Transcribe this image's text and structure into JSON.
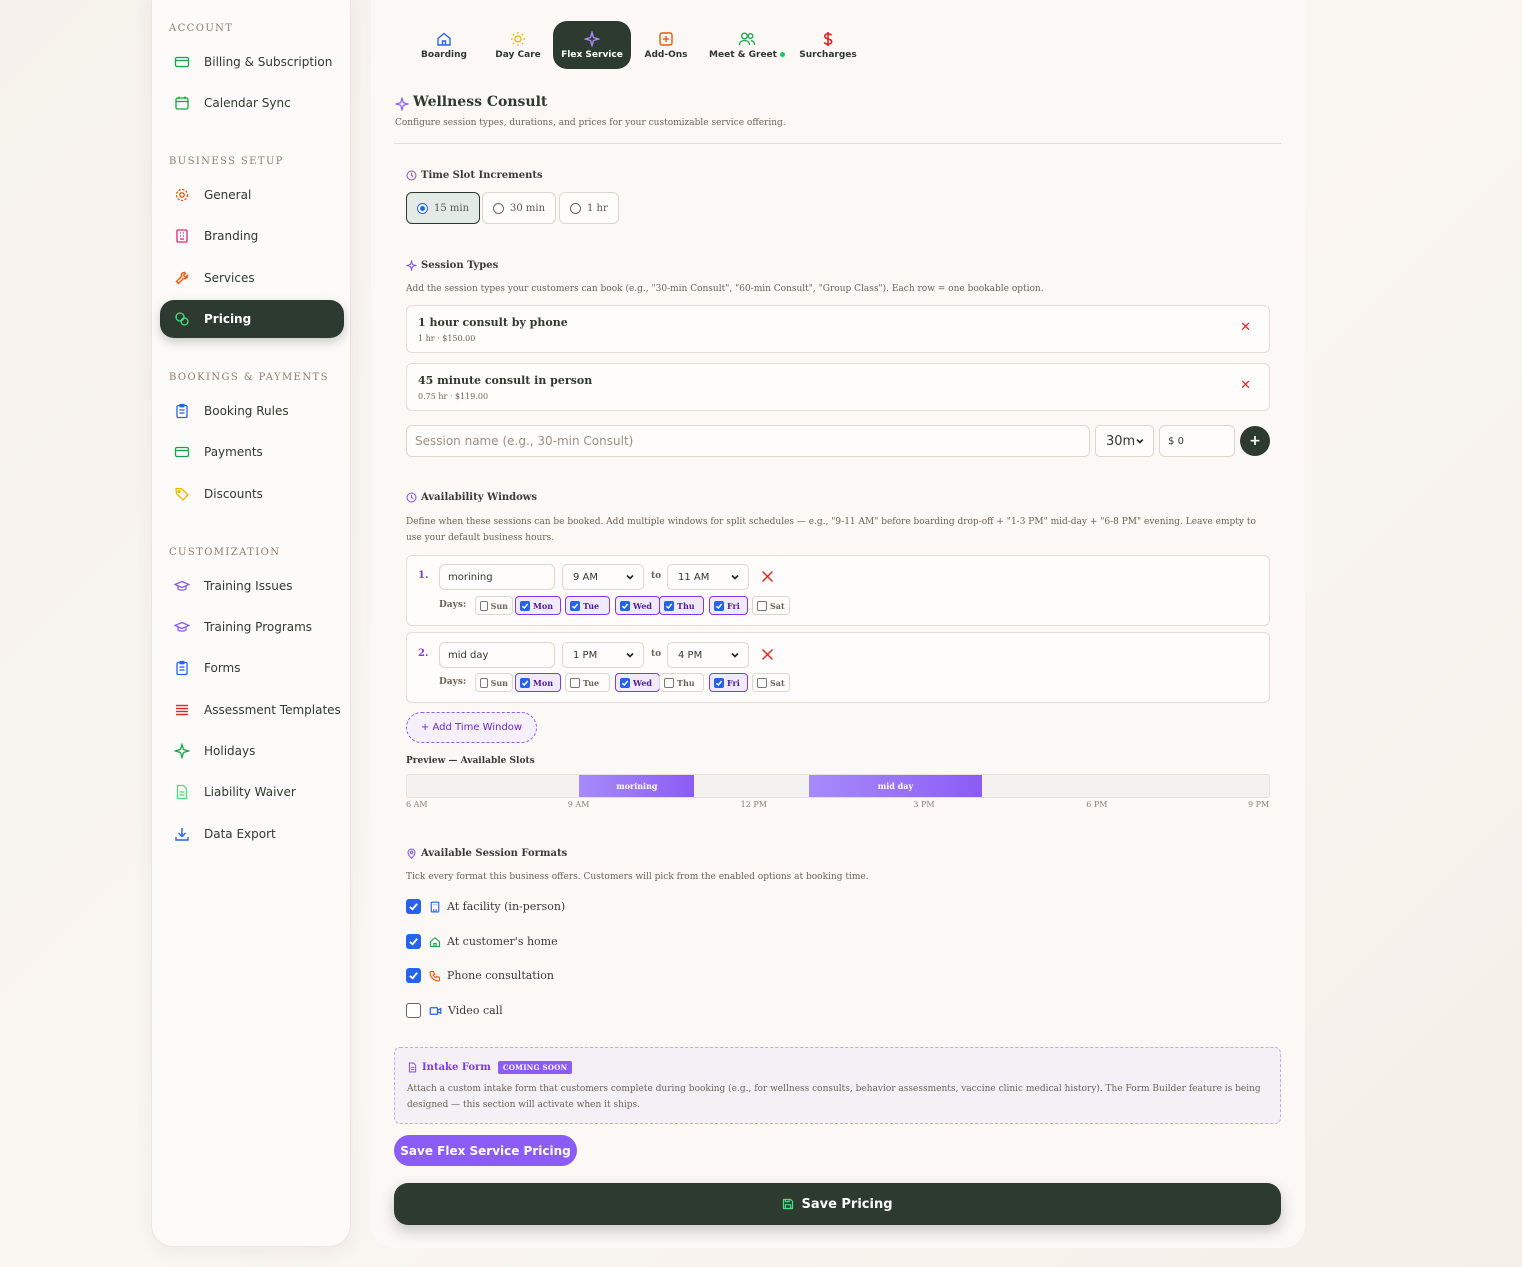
{
  "sidebar": {
    "sections": {
      "account": "ACCOUNT",
      "business_setup": "BUSINESS SETUP",
      "bookings_payments": "BOOKINGS & PAYMENTS",
      "customization": "CUSTOMIZATION"
    },
    "items": {
      "billing": "Billing & Subscription",
      "calendar": "Calendar Sync",
      "general": "General",
      "branding": "Branding",
      "services": "Services",
      "pricing": "Pricing",
      "booking_rules": "Booking Rules",
      "payments": "Payments",
      "discounts": "Discounts",
      "training_issues": "Training Issues",
      "training_programs": "Training Programs",
      "forms": "Forms",
      "assessment_templates": "Assessment Templates",
      "holidays": "Holidays",
      "liability_waiver": "Liability Waiver",
      "data_export": "Data Export"
    },
    "active": "pricing"
  },
  "tabs": [
    {
      "label": "Boarding",
      "icon": "home-icon",
      "color": "#2563eb"
    },
    {
      "label": "Day Care",
      "icon": "sun-icon",
      "color": "#eab308"
    },
    {
      "label": "Flex Service",
      "icon": "sparkle-icon",
      "color": "#8b5cf6"
    },
    {
      "label": "Add-Ons",
      "icon": "plus-square-icon",
      "color": "#ea580c"
    },
    {
      "label": "Meet & Greet",
      "icon": "users-icon",
      "color": "#16a34a"
    },
    {
      "label": "Surcharges",
      "icon": "dollar-icon",
      "color": "#dc2626"
    }
  ],
  "header": {
    "title": "Wellness Consult",
    "subtitle": "Configure session types, durations, and prices for your customizable service offering."
  },
  "time_slots": {
    "title": "Time Slot Increments",
    "options": [
      "15 min",
      "30 min",
      "1 hr"
    ],
    "selected": "15 min"
  },
  "session_types": {
    "title": "Session Types",
    "description": "Add the session types your customers can book (e.g., \"30-min Consult\", \"60-min Consult\", \"Group Class\"). Each row = one bookable option.",
    "items": [
      {
        "name": "1 hour consult by phone",
        "meta": "1 hr · $150.00"
      },
      {
        "name": "45 minute consult in person",
        "meta": "0.75 hr · $119.00"
      }
    ],
    "new_placeholder": "Session name (e.g., 30-min Consult)",
    "duration": "30m",
    "price_prefix": "$",
    "price_value": "0",
    "add_label": "+"
  },
  "availability": {
    "title": "Availability Windows",
    "description": "Define when these sessions can be booked. Add multiple windows for split schedules — e.g., \"9-11 AM\" before boarding drop-off + \"1-3 PM\" mid-day + \"6-8 PM\" evening. Leave empty to use your default business hours.",
    "to_label": "to",
    "days_label": "Days:",
    "day_names": [
      "Sun",
      "Mon",
      "Tue",
      "Wed",
      "Thu",
      "Fri",
      "Sat"
    ],
    "windows": [
      {
        "num": "1.",
        "name": "morining",
        "start": "9 AM",
        "end": "11 AM",
        "days": [
          false,
          true,
          true,
          true,
          true,
          true,
          false
        ]
      },
      {
        "num": "2.",
        "name": "mid day",
        "start": "1 PM",
        "end": "4 PM",
        "days": [
          false,
          true,
          false,
          true,
          false,
          true,
          false
        ]
      }
    ],
    "add_label": "+ Add Time Window",
    "preview_label": "Preview — Available Slots",
    "preview": {
      "range_hours": [
        6,
        21
      ],
      "slots": [
        {
          "label": "morining",
          "start": 9,
          "end": 11
        },
        {
          "label": "mid day",
          "start": 13,
          "end": 16
        }
      ],
      "ticks": [
        "6 AM",
        "9 AM",
        "12 PM",
        "3 PM",
        "6 PM",
        "9 PM"
      ]
    }
  },
  "formats": {
    "title": "Available Session Formats",
    "description": "Tick every format this business offers. Customers will pick from the enabled options at booking time.",
    "items": [
      {
        "label": "At facility (in-person)",
        "checked": true,
        "icon": "building-icon",
        "color": "#2563eb"
      },
      {
        "label": "At customer's home",
        "checked": true,
        "icon": "home-icon",
        "color": "#16a34a"
      },
      {
        "label": "Phone consultation",
        "checked": true,
        "icon": "phone-icon",
        "color": "#ea580c"
      },
      {
        "label": "Video call",
        "checked": false,
        "icon": "video-icon",
        "color": "#2563eb"
      }
    ]
  },
  "intake": {
    "title": "Intake Form",
    "badge": "COMING SOON",
    "description": "Attach a custom intake form that customers complete during booking (e.g., for wellness consults, behavior assessments, vaccine clinic medical history). The Form Builder feature is being designed — this section will activate when it ships."
  },
  "buttons": {
    "save_flex": "Save Flex Service Pricing",
    "save_pricing": "Save Pricing"
  },
  "colors": {
    "dark_green": "#2d3a2f",
    "purple": "#8b5cf6",
    "blue": "#2563eb",
    "red": "#dc2626"
  }
}
